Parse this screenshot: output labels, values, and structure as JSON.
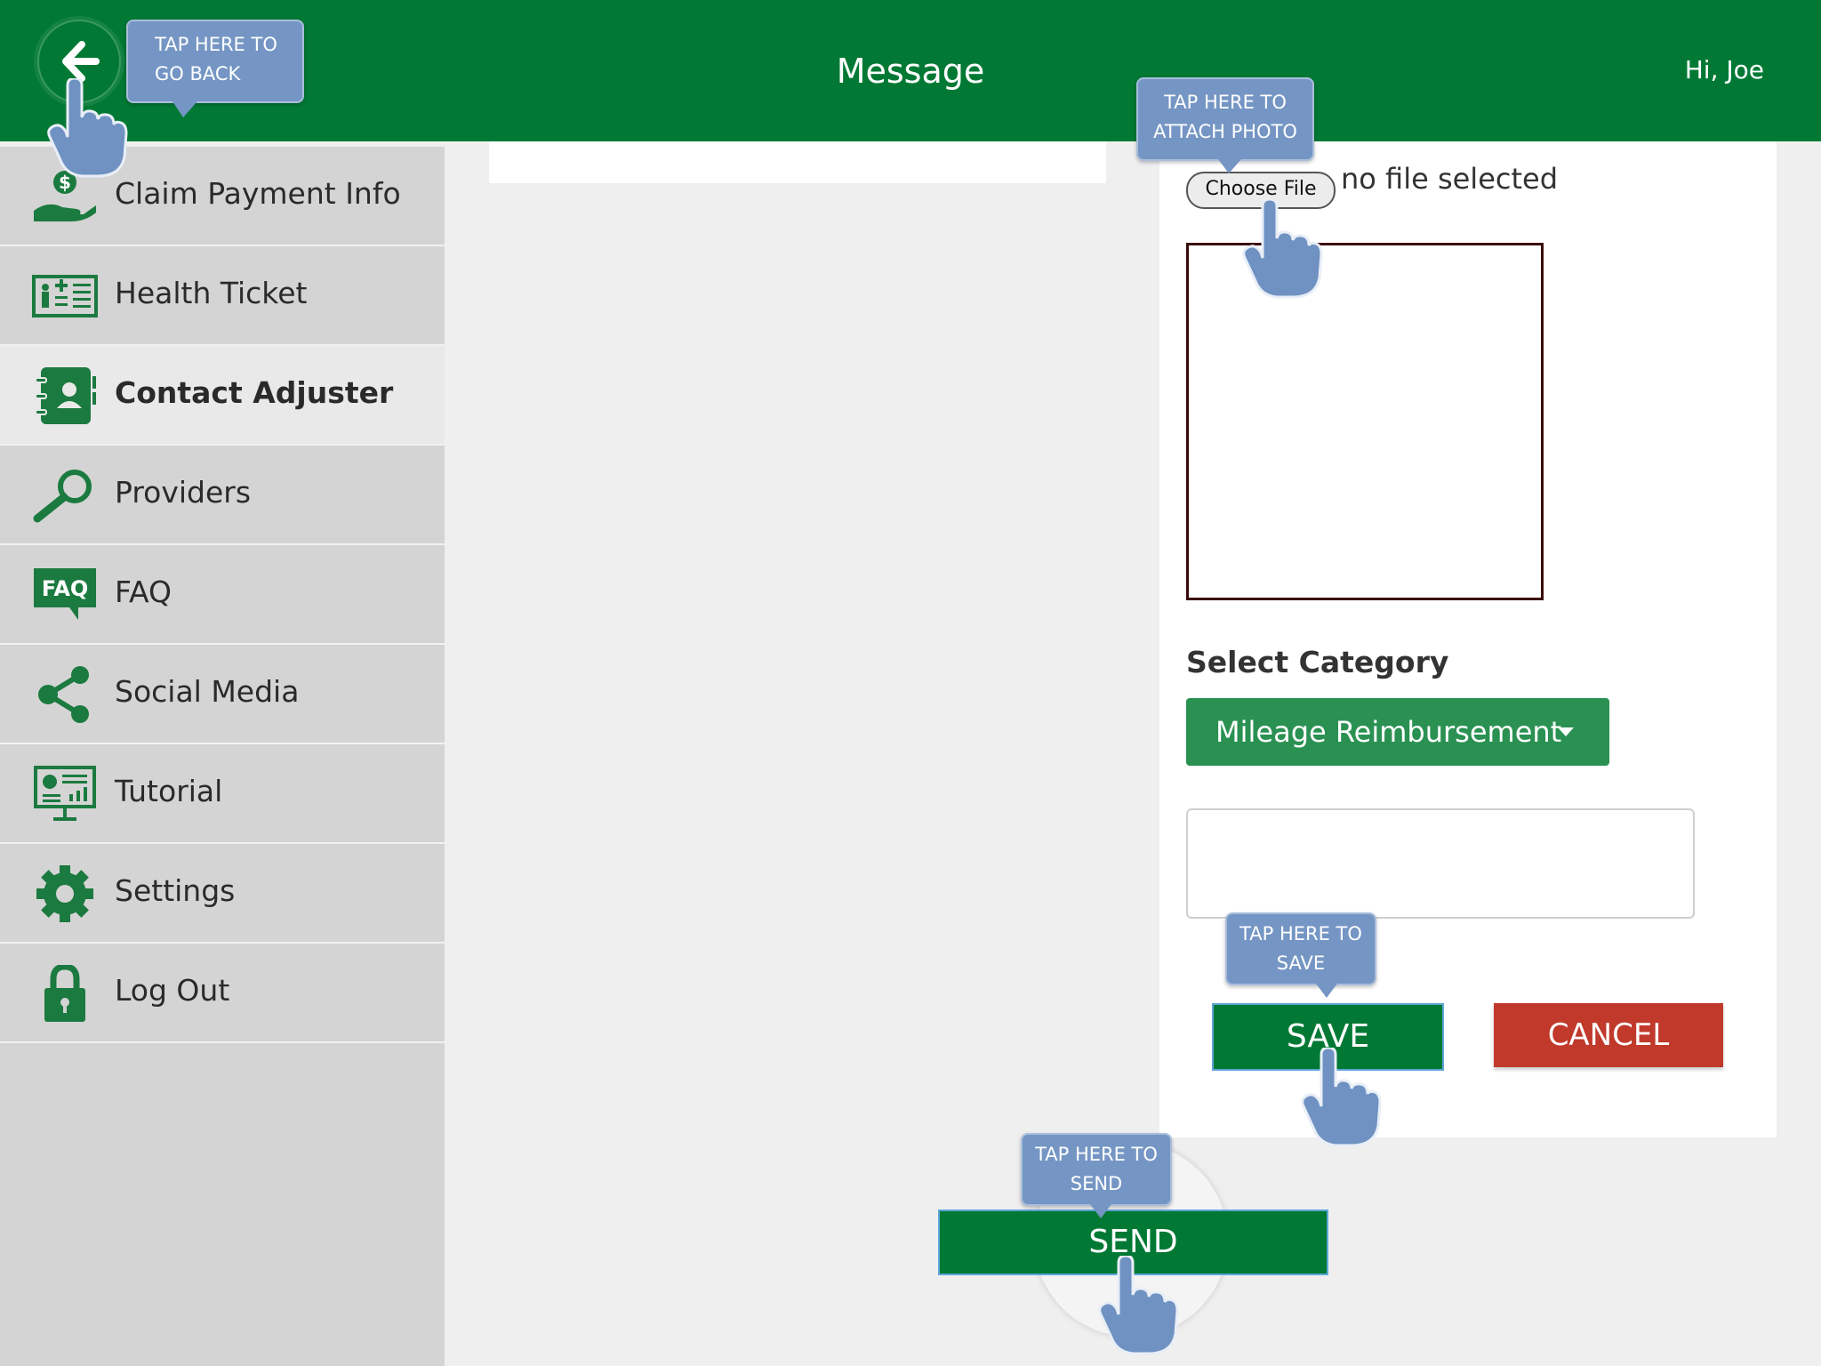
{
  "header": {
    "title": "Message",
    "greeting": "Hi, Joe",
    "background": "#017934"
  },
  "sidebar": {
    "items": [
      {
        "label": "Claim Payment Info",
        "icon": "hand-dollar-icon"
      },
      {
        "label": "Health Ticket",
        "icon": "health-ticket-icon"
      },
      {
        "label": "Contact Adjuster",
        "icon": "contact-book-icon",
        "active": true
      },
      {
        "label": "Providers",
        "icon": "magnifier-icon"
      },
      {
        "label": "FAQ",
        "icon": "faq-icon"
      },
      {
        "label": "Social Media",
        "icon": "share-icon"
      },
      {
        "label": "Tutorial",
        "icon": "presentation-icon"
      },
      {
        "label": "Settings",
        "icon": "gear-icon"
      },
      {
        "label": "Log Out",
        "icon": "lock-icon"
      }
    ]
  },
  "form": {
    "choose_file_label": "Choose File",
    "file_status": "no file selected",
    "category_label": "Select Category",
    "category_value": "Mileage Reimbursement",
    "save_label": "SAVE",
    "cancel_label": "CANCEL",
    "send_label": "SEND"
  },
  "callouts": {
    "back": [
      "TAP HERE TO",
      "GO BACK"
    ],
    "attach": [
      "TAP HERE TO",
      "ATTACH PHOTO"
    ],
    "save": [
      "TAP HERE TO",
      "SAVE"
    ],
    "send": [
      "TAP HERE TO",
      "SEND"
    ]
  },
  "colors": {
    "brand_green": "#017934",
    "dropdown_green": "#2a9152",
    "cancel_red": "#c0392b",
    "callout_blue": "#7596c4"
  }
}
